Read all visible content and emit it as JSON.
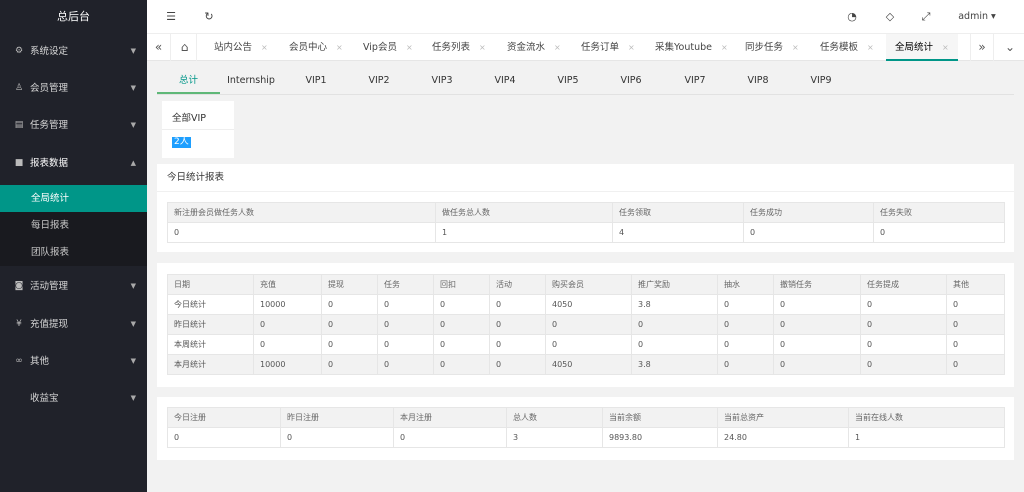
{
  "sidebar": {
    "brand": "总后台",
    "menu": [
      {
        "label": "系统设定",
        "icon": "gear-icon",
        "glyph": "⚙"
      },
      {
        "label": "会员管理",
        "icon": "user-icon",
        "glyph": "♙"
      },
      {
        "label": "任务管理",
        "icon": "document-icon",
        "glyph": "▤"
      },
      {
        "label": "报表数据",
        "icon": "chat-icon",
        "glyph": "■"
      },
      {
        "label": "活动管理",
        "icon": "gamepad-icon",
        "glyph": "◙"
      },
      {
        "label": "充值提现",
        "icon": "yen-icon",
        "glyph": "¥"
      },
      {
        "label": "其他",
        "icon": "link-icon",
        "glyph": "∞"
      },
      {
        "label": "收益宝",
        "icon": "",
        "glyph": ""
      }
    ],
    "submenu": [
      "全局统计",
      "每日报表",
      "团队报表"
    ]
  },
  "header": {
    "menu_icon": "☰",
    "refresh_icon": "↻",
    "theme_icon": "◔",
    "note_icon": "◇",
    "fullscreen_icon": "⤢",
    "user": "admin ▾"
  },
  "tabs": {
    "home_icon": "⌂",
    "prev_icon": "«",
    "next_icon": "»",
    "more_icon": "⌄",
    "close": "×",
    "items": [
      "站内公告",
      "会员中心",
      "Vip会员",
      "任务列表",
      "资金流水",
      "任务订单",
      "采集Youtube",
      "同步任务",
      "任务模板",
      "全局统计"
    ]
  },
  "vip_tabs": [
    "总计",
    "Internship",
    "VIP1",
    "VIP2",
    "VIP3",
    "VIP4",
    "VIP5",
    "VIP6",
    "VIP7",
    "VIP8",
    "VIP9"
  ],
  "filter": {
    "title": "全部VIP",
    "count": "2人"
  },
  "today": {
    "title": "今日统计报表",
    "headers": [
      "新注册会员做任务人数",
      "做任务总人数",
      "任务领取",
      "任务成功",
      "任务失败"
    ],
    "values": [
      "0",
      "1",
      "4",
      "0",
      "0"
    ]
  },
  "stats": {
    "headers": [
      "日期",
      "充值",
      "提现",
      "任务",
      "回扣",
      "活动",
      "购买会员",
      "推广奖励",
      "抽水",
      "撤销任务",
      "任务提成",
      "其他"
    ],
    "rows": [
      [
        "今日统计",
        "10000",
        "0",
        "0",
        "0",
        "0",
        "4050",
        "3.8",
        "0",
        "0",
        "0",
        "0"
      ],
      [
        "昨日统计",
        "0",
        "0",
        "0",
        "0",
        "0",
        "0",
        "0",
        "0",
        "0",
        "0",
        "0"
      ],
      [
        "本周统计",
        "0",
        "0",
        "0",
        "0",
        "0",
        "0",
        "0",
        "0",
        "0",
        "0",
        "0"
      ],
      [
        "本月统计",
        "10000",
        "0",
        "0",
        "0",
        "0",
        "4050",
        "3.8",
        "0",
        "0",
        "0",
        "0"
      ]
    ]
  },
  "summary": {
    "headers": [
      "今日注册",
      "昨日注册",
      "本月注册",
      "总人数",
      "当前余额",
      "当前总资产",
      "当前在线人数"
    ],
    "values": [
      "0",
      "0",
      "0",
      "3",
      "9893.80",
      "24.80",
      "1"
    ]
  }
}
